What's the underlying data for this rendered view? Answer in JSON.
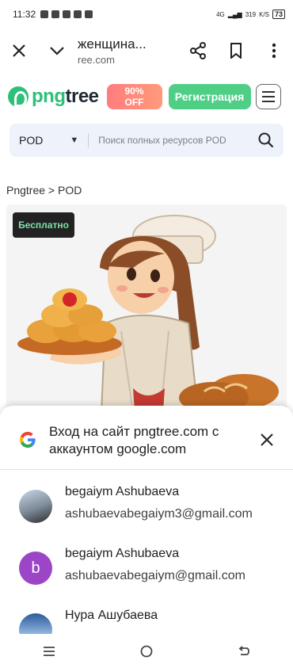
{
  "status_bar": {
    "time": "11:32",
    "network": "4G",
    "speed": "319",
    "speed_unit": "K/S",
    "battery": "73"
  },
  "browser": {
    "title": "женщина...",
    "url": "ree.com"
  },
  "site": {
    "logo_text_green": "png",
    "logo_text_dark": "tree",
    "promo_line1": "90%",
    "promo_line2": "OFF",
    "register_label": "Регистрация"
  },
  "search": {
    "category": "POD",
    "placeholder": "Поиск полных ресурсов POD"
  },
  "breadcrumb": "Pngtree > POD",
  "card": {
    "badge": "Бесплатно"
  },
  "google_sheet": {
    "title": "Вход на сайт pngtree.com с аккаунтом google.com",
    "accounts": [
      {
        "name": "begaiym Ashubaeva",
        "email": "ashubaevabegaiym3@gmail.com",
        "avatar": "photo"
      },
      {
        "name": "begaiym Ashubaeva",
        "email": "ashubaevabegaiym@gmail.com",
        "avatar": "b"
      },
      {
        "name": "Нура Ашубаева",
        "email": "",
        "avatar": "photo"
      }
    ]
  },
  "colors": {
    "brand_green": "#2ec07a",
    "register_green": "#4fcf86",
    "promo_red": "#ff7d7d",
    "badge_text": "#7ee2a8",
    "avatar_purple": "#9c46c7"
  }
}
